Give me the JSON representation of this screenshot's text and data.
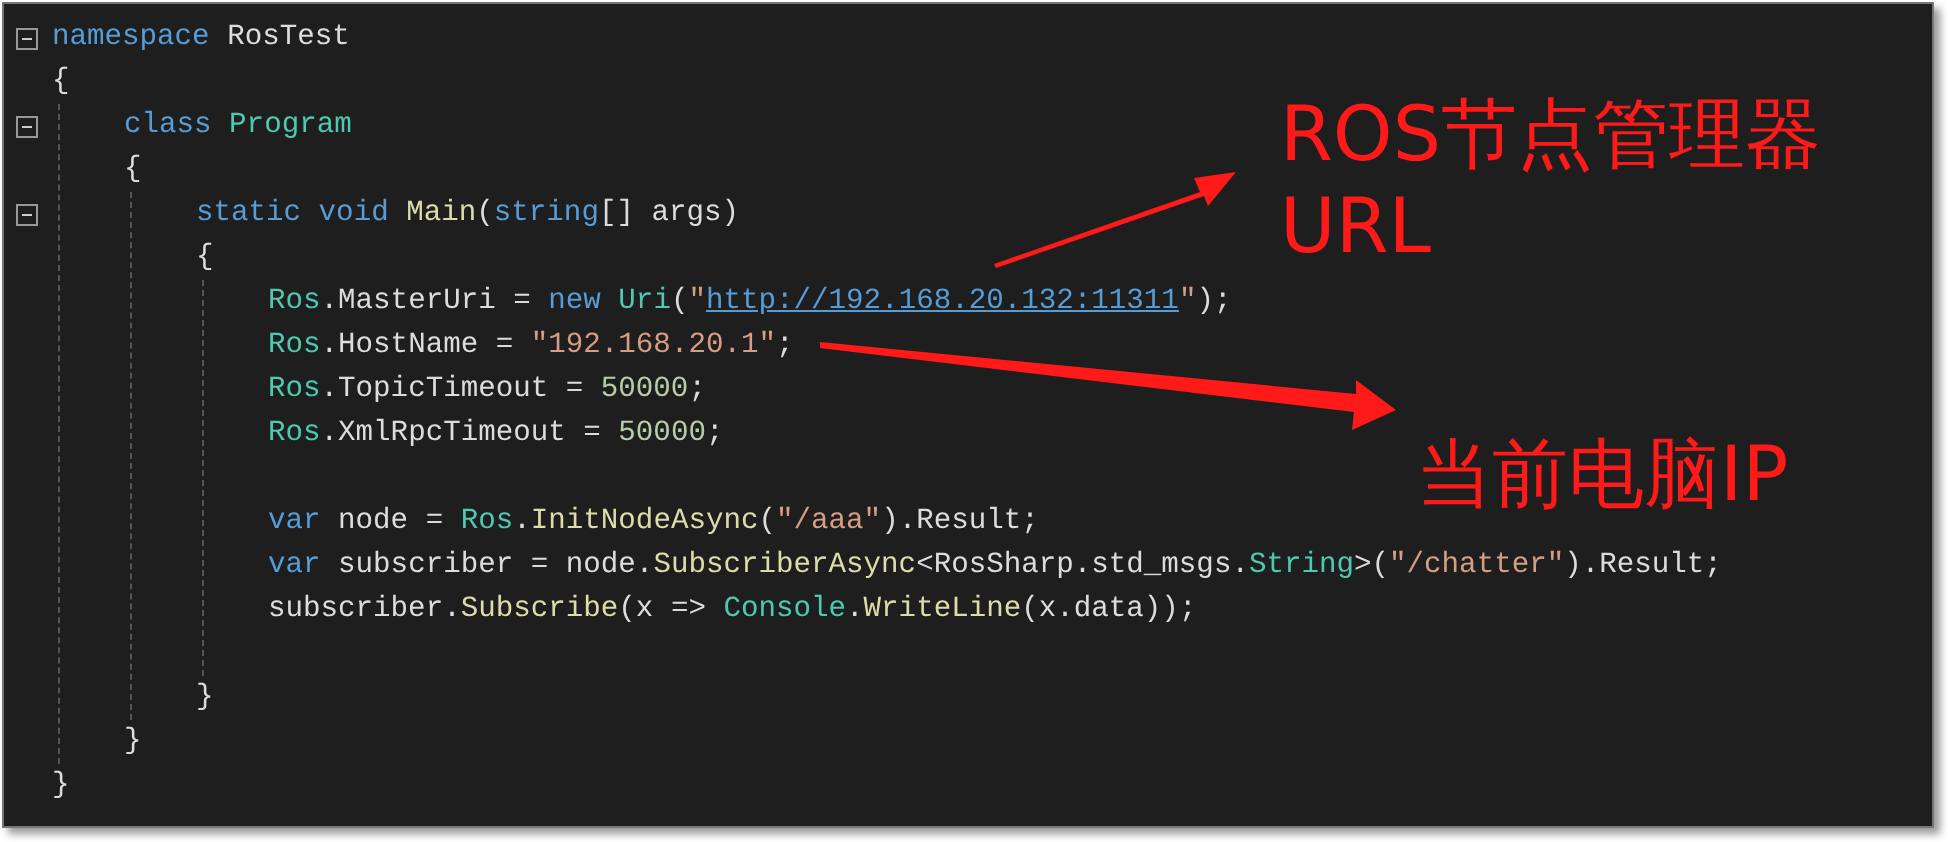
{
  "editor": {
    "lines": [
      {
        "kind": "code",
        "collapsible": true,
        "tokens": [
          {
            "kind": "keyword",
            "text": "namespace"
          },
          {
            "kind": "plain",
            "text": " RosTest"
          }
        ]
      },
      {
        "kind": "code",
        "collapsible": false,
        "tokens": [
          {
            "kind": "plain",
            "text": "{"
          }
        ],
        "children": [
          {
            "kind": "code",
            "collapsible": true,
            "tokens": [
              {
                "kind": "keyword",
                "text": "class"
              },
              {
                "kind": "type",
                "text": " Program"
              }
            ]
          },
          {
            "kind": "code",
            "collapsible": false,
            "tokens": [
              {
                "kind": "plain",
                "text": "{"
              }
            ],
            "children": [
              {
                "kind": "code",
                "collapsible": true,
                "tokens": [
                  {
                    "kind": "keyword",
                    "text": "static void"
                  },
                  {
                    "kind": "method",
                    "text": " Main"
                  },
                  {
                    "kind": "plain",
                    "text": "("
                  },
                  {
                    "kind": "keyword",
                    "text": "string"
                  },
                  {
                    "kind": "plain",
                    "text": "[] args)"
                  }
                ]
              },
              {
                "kind": "code",
                "collapsible": false,
                "tokens": [
                  {
                    "kind": "plain",
                    "text": "{"
                  }
                ],
                "children": [
                  {
                    "kind": "code",
                    "collapsible": false,
                    "tokens": [
                      {
                        "kind": "type",
                        "text": "Ros"
                      },
                      {
                        "kind": "plain",
                        "text": ".MasterUri = "
                      },
                      {
                        "kind": "keyword",
                        "text": "new"
                      },
                      {
                        "kind": "type",
                        "text": " Uri"
                      },
                      {
                        "kind": "plain",
                        "text": "("
                      },
                      {
                        "kind": "string",
                        "text": "\""
                      },
                      {
                        "kind": "link",
                        "text": "http://192.168.20.132:11311"
                      },
                      {
                        "kind": "string",
                        "text": "\""
                      },
                      {
                        "kind": "plain",
                        "text": ");"
                      }
                    ]
                  },
                  {
                    "kind": "code",
                    "collapsible": false,
                    "tokens": [
                      {
                        "kind": "type",
                        "text": "Ros"
                      },
                      {
                        "kind": "plain",
                        "text": ".HostName = "
                      },
                      {
                        "kind": "string",
                        "text": "\"192.168.20.1\""
                      },
                      {
                        "kind": "plain",
                        "text": ";"
                      }
                    ]
                  },
                  {
                    "kind": "code",
                    "collapsible": false,
                    "tokens": [
                      {
                        "kind": "type",
                        "text": "Ros"
                      },
                      {
                        "kind": "plain",
                        "text": ".TopicTimeout = "
                      },
                      {
                        "kind": "number",
                        "text": "50000"
                      },
                      {
                        "kind": "plain",
                        "text": ";"
                      }
                    ]
                  },
                  {
                    "kind": "code",
                    "collapsible": false,
                    "tokens": [
                      {
                        "kind": "type",
                        "text": "Ros"
                      },
                      {
                        "kind": "plain",
                        "text": ".XmlRpcTimeout = "
                      },
                      {
                        "kind": "number",
                        "text": "50000"
                      },
                      {
                        "kind": "plain",
                        "text": ";"
                      }
                    ]
                  },
                  {
                    "kind": "blank",
                    "collapsible": false
                  },
                  {
                    "kind": "code",
                    "collapsible": false,
                    "tokens": [
                      {
                        "kind": "keyword",
                        "text": "var"
                      },
                      {
                        "kind": "plain",
                        "text": " node = "
                      },
                      {
                        "kind": "type",
                        "text": "Ros"
                      },
                      {
                        "kind": "plain",
                        "text": "."
                      },
                      {
                        "kind": "method",
                        "text": "InitNodeAsync"
                      },
                      {
                        "kind": "plain",
                        "text": "("
                      },
                      {
                        "kind": "string",
                        "text": "\"/aaa\""
                      },
                      {
                        "kind": "plain",
                        "text": ").Result;"
                      }
                    ]
                  },
                  {
                    "kind": "code",
                    "collapsible": false,
                    "tokens": [
                      {
                        "kind": "keyword",
                        "text": "var"
                      },
                      {
                        "kind": "plain",
                        "text": " subscriber = node."
                      },
                      {
                        "kind": "method",
                        "text": "SubscriberAsync"
                      },
                      {
                        "kind": "plain",
                        "text": "<RosSharp.std_msgs."
                      },
                      {
                        "kind": "type",
                        "text": "String"
                      },
                      {
                        "kind": "plain",
                        "text": ">("
                      },
                      {
                        "kind": "string",
                        "text": "\"/chatter\""
                      },
                      {
                        "kind": "plain",
                        "text": ").Result;"
                      }
                    ]
                  },
                  {
                    "kind": "code",
                    "collapsible": false,
                    "tokens": [
                      {
                        "kind": "plain",
                        "text": "subscriber."
                      },
                      {
                        "kind": "method",
                        "text": "Subscribe"
                      },
                      {
                        "kind": "plain",
                        "text": "(x => "
                      },
                      {
                        "kind": "type",
                        "text": "Console"
                      },
                      {
                        "kind": "plain",
                        "text": "."
                      },
                      {
                        "kind": "method",
                        "text": "WriteLine"
                      },
                      {
                        "kind": "plain",
                        "text": "(x.data));"
                      }
                    ]
                  },
                  {
                    "kind": "blank",
                    "collapsible": false
                  }
                ]
              },
              {
                "kind": "code",
                "collapsible": false,
                "tokens": [
                  {
                    "kind": "plain",
                    "text": "}"
                  }
                ]
              }
            ]
          },
          {
            "kind": "code",
            "collapsible": false,
            "tokens": [
              {
                "kind": "plain",
                "text": "}"
              }
            ]
          }
        ]
      },
      {
        "kind": "code",
        "collapsible": false,
        "tokens": [
          {
            "kind": "plain",
            "text": "}"
          }
        ]
      }
    ]
  },
  "annotations": [
    {
      "lines": [
        "ROS节点管理器",
        "URL"
      ]
    },
    {
      "lines": [
        "当前电脑IP"
      ]
    }
  ]
}
